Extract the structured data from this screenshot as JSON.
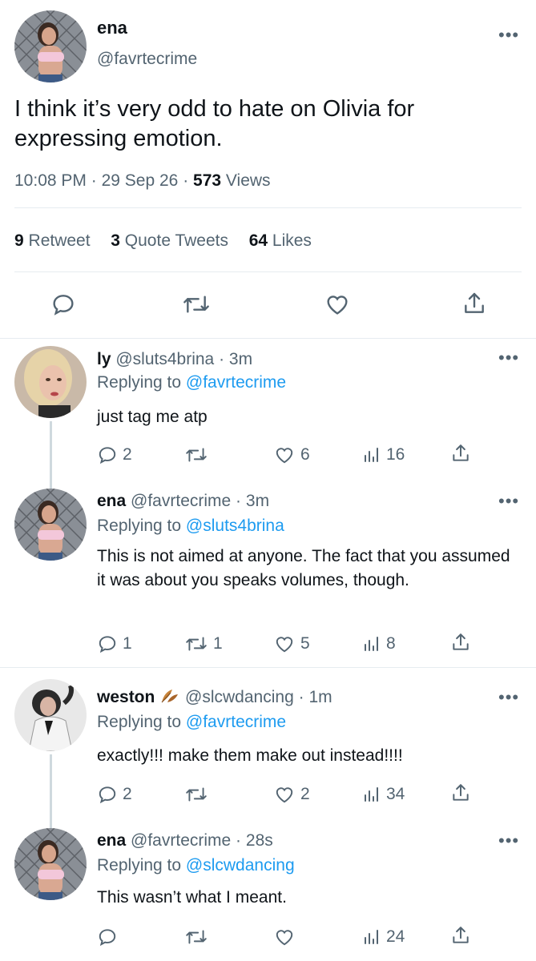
{
  "main_tweet": {
    "name": "ena",
    "handle": "@favrtecrime",
    "text": "I think it’s very odd to hate on Olivia for expressing emotion.",
    "time": "10:08 PM",
    "date": "29 Sep 26",
    "views_count": "573",
    "views_label": "Views",
    "retweets_count": "9",
    "retweets_label": "Retweet",
    "quotes_count": "3",
    "quotes_label": "Quote Tweets",
    "likes_count": "64",
    "likes_label": "Likes"
  },
  "replies": [
    {
      "name": "ly",
      "handle": "@sluts4brina",
      "time": "3m",
      "replying_label": "Replying to",
      "replying_to": "@favrtecrime",
      "text": "just tag me atp",
      "replies": "2",
      "retweets": "",
      "likes": "6",
      "views": "16"
    },
    {
      "name": "ena",
      "handle": "@favrtecrime",
      "time": "3m",
      "replying_label": "Replying to",
      "replying_to": "@sluts4brina",
      "text": "This is not aimed at anyone. The fact that you assumed it was about you speaks volumes, though.",
      "replies": "1",
      "retweets": "1",
      "likes": "5",
      "views": "8"
    },
    {
      "name": "weston",
      "handle": "@slcwdancing",
      "time": "1m",
      "replying_label": "Replying to",
      "replying_to": "@favrtecrime",
      "text": "exactly!!! make them make out instead!!!!",
      "replies": "2",
      "retweets": "",
      "likes": "2",
      "views": "34"
    },
    {
      "name": "ena",
      "handle": "@favrtecrime",
      "time": "28s",
      "replying_label": "Replying to",
      "replying_to": "@slcwdancing",
      "text": "This wasn’t what I meant.",
      "replies": "",
      "retweets": "",
      "likes": "",
      "views": "24"
    }
  ],
  "separator": "·",
  "colors": {
    "text": "#0f1419",
    "secondary": "#536471",
    "link": "#1d9bf0",
    "divider": "#e6ecf0"
  },
  "icons": [
    "more-icon",
    "reply-icon",
    "retweet-icon",
    "like-icon",
    "share-icon",
    "views-icon",
    "leaf-emoji"
  ]
}
